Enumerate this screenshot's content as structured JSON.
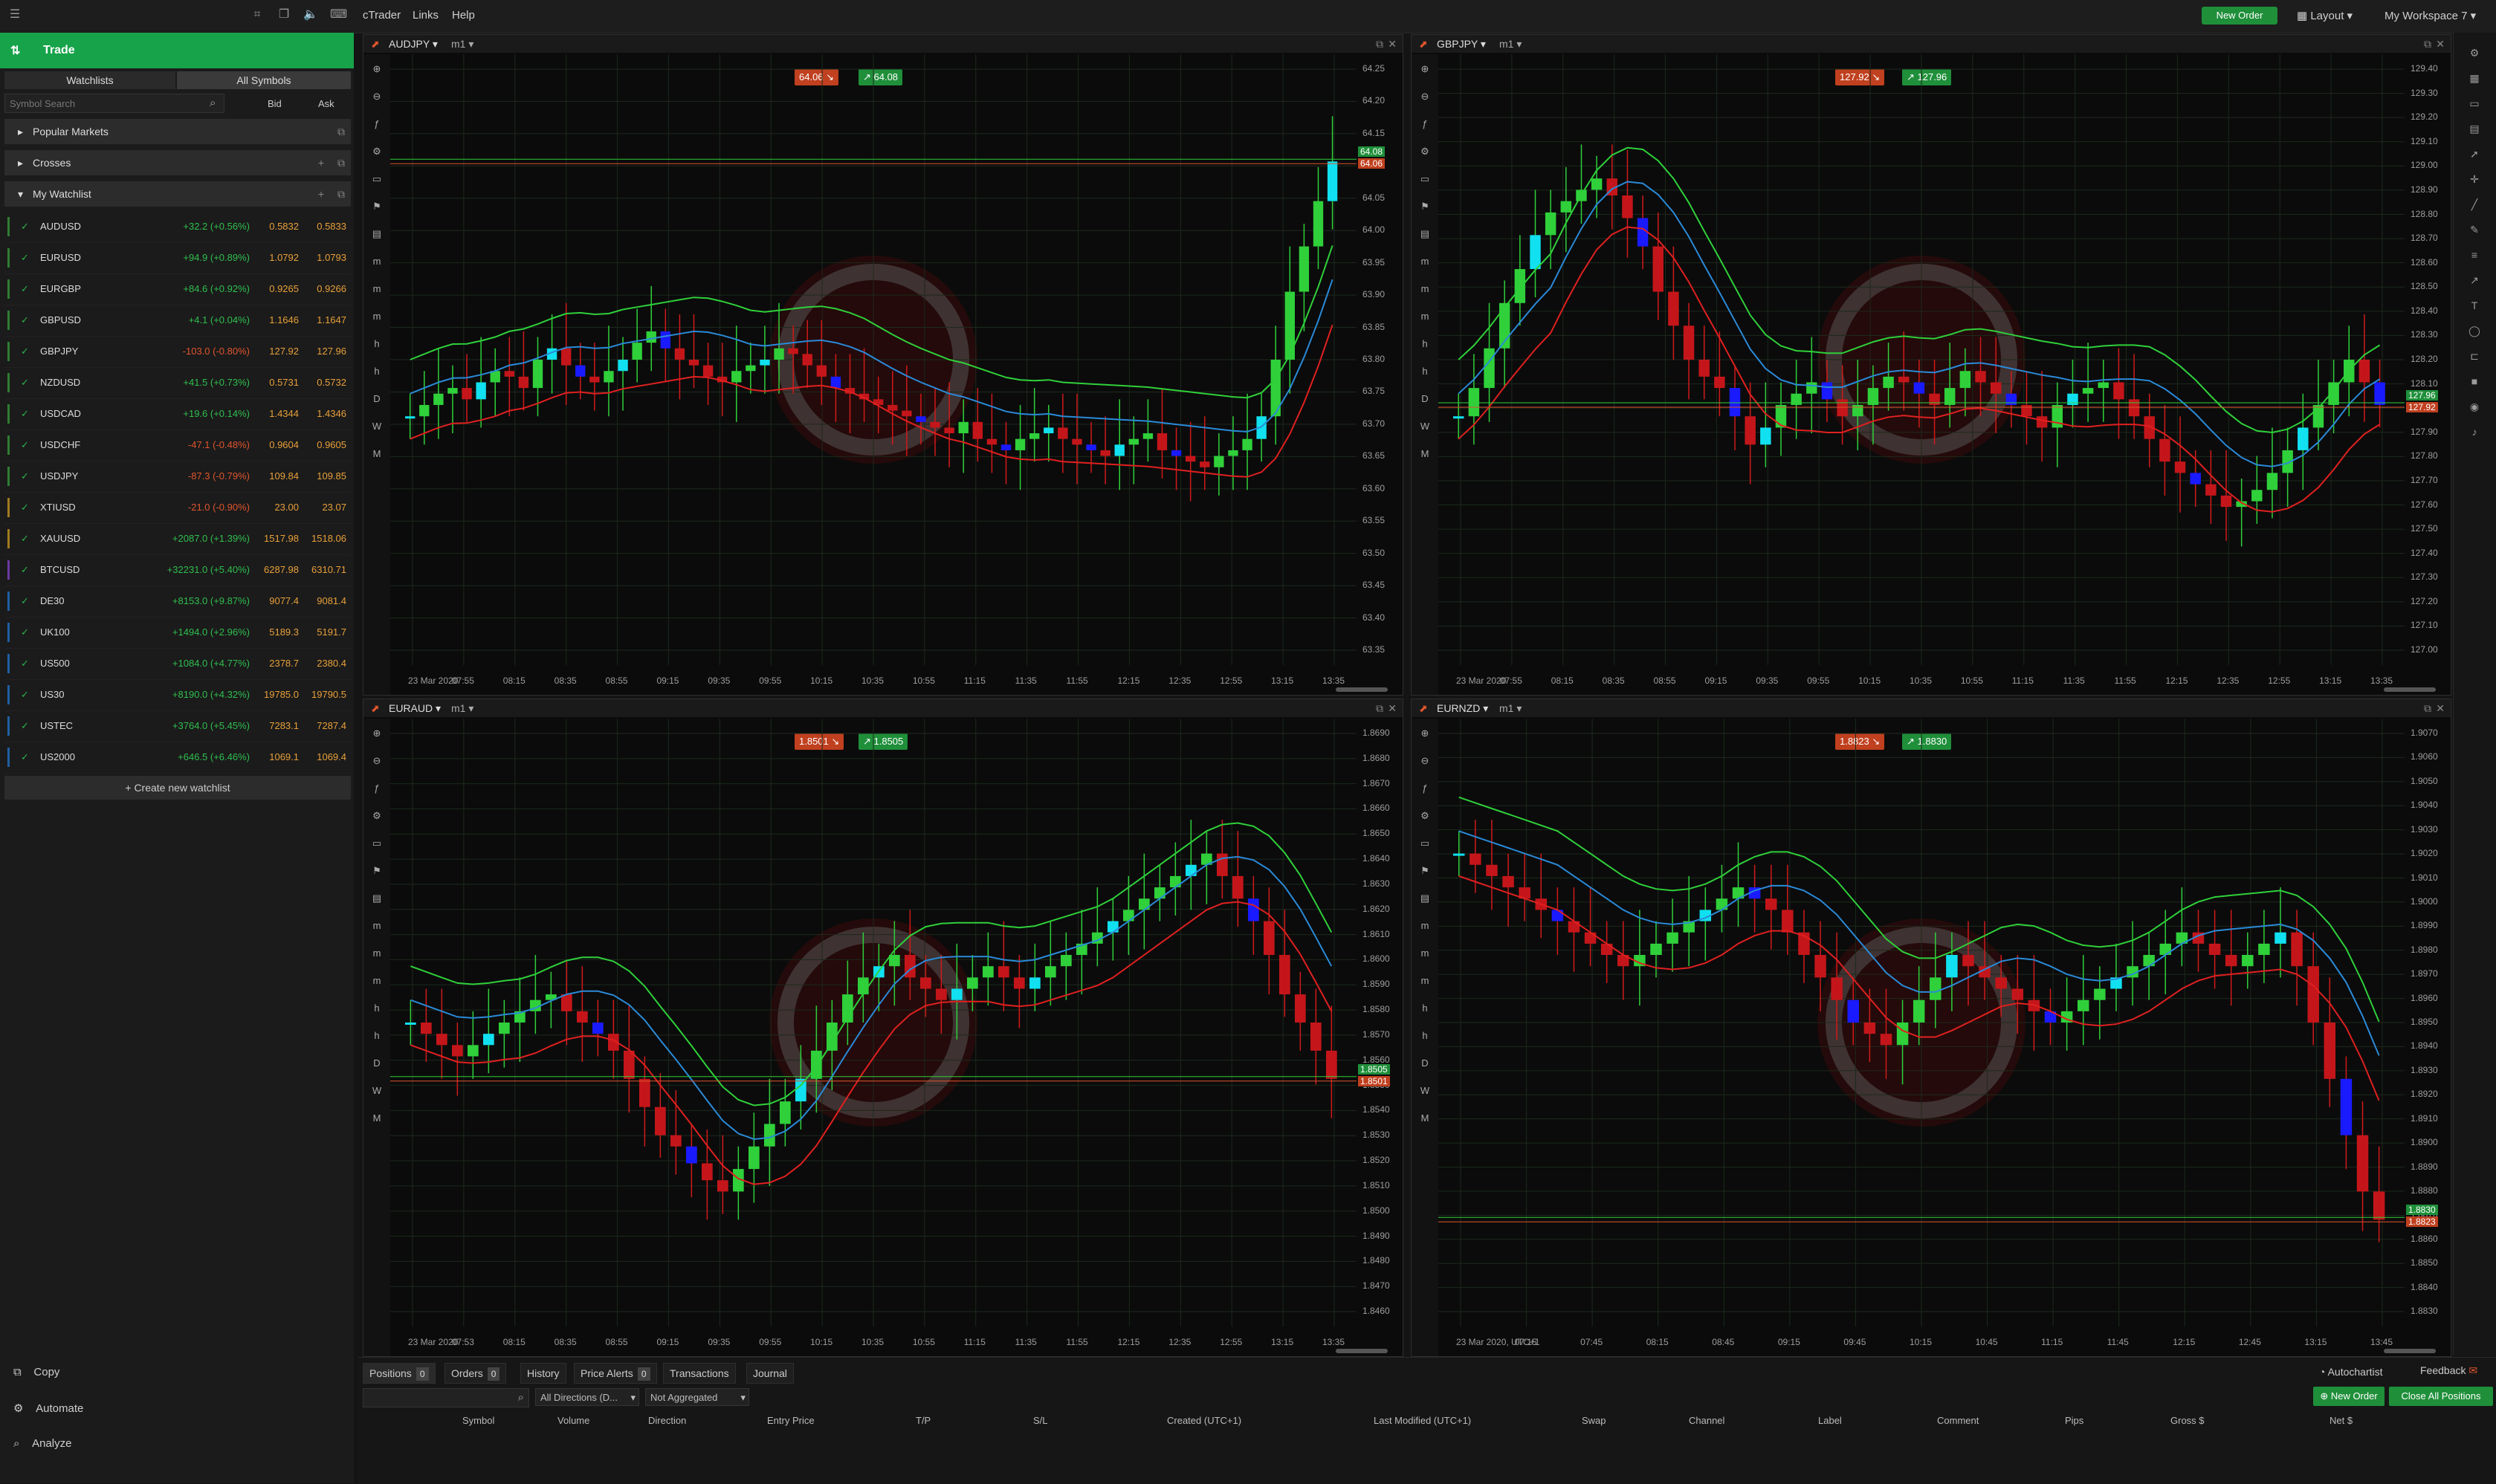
{
  "topbar": {
    "menu": [
      "cTrader",
      "Links",
      "Help"
    ],
    "new_order": "New Order",
    "layout": "Layout",
    "workspace": "My Workspace 7"
  },
  "sidebar": {
    "title": "Trade",
    "tabs": [
      "Watchlists",
      "All Symbols"
    ],
    "search_placeholder": "Symbol Search",
    "col_bid": "Bid",
    "col_ask": "Ask",
    "groups": [
      "Popular Markets",
      "Crosses",
      "My Watchlist"
    ],
    "watchlist": [
      {
        "symbol": "AUDUSD",
        "change": "+32.2 (+0.56%)",
        "bid": "0.5832",
        "ask": "0.5833",
        "color": "#2fbf4f"
      },
      {
        "symbol": "EURUSD",
        "change": "+94.9 (+0.89%)",
        "bid": "1.0792",
        "ask": "1.0793",
        "color": "#2fbf4f"
      },
      {
        "symbol": "EURGBP",
        "change": "+84.6 (+0.92%)",
        "bid": "0.9265",
        "ask": "0.9266",
        "color": "#2fbf4f"
      },
      {
        "symbol": "GBPUSD",
        "change": "+4.1 (+0.04%)",
        "bid": "1.1646",
        "ask": "1.1647",
        "color": "#2fbf4f"
      },
      {
        "symbol": "GBPJPY",
        "change": "-103.0 (-0.80%)",
        "bid": "127.92",
        "ask": "127.96",
        "color": "#e0552d"
      },
      {
        "symbol": "NZDUSD",
        "change": "+41.5 (+0.73%)",
        "bid": "0.5731",
        "ask": "0.5732",
        "color": "#2fbf4f"
      },
      {
        "symbol": "USDCAD",
        "change": "+19.6 (+0.14%)",
        "bid": "1.4344",
        "ask": "1.4346",
        "color": "#2fbf4f"
      },
      {
        "symbol": "USDCHF",
        "change": "-47.1 (-0.48%)",
        "bid": "0.9604",
        "ask": "0.9605",
        "color": "#e0552d"
      },
      {
        "symbol": "USDJPY",
        "change": "-87.3 (-0.79%)",
        "bid": "109.84",
        "ask": "109.85",
        "color": "#e0552d"
      },
      {
        "symbol": "XTIUSD",
        "change": "-21.0 (-0.90%)",
        "bid": "23.00",
        "ask": "23.07",
        "color": "#e0552d"
      },
      {
        "symbol": "XAUUSD",
        "change": "+2087.0 (+1.39%)",
        "bid": "1517.98",
        "ask": "1518.06",
        "color": "#2fbf4f"
      },
      {
        "symbol": "BTCUSD",
        "change": "+32231.0 (+5.40%)",
        "bid": "6287.98",
        "ask": "6310.71",
        "color": "#2fbf4f"
      },
      {
        "symbol": "DE30",
        "change": "+8153.0 (+9.87%)",
        "bid": "9077.4",
        "ask": "9081.4",
        "color": "#2fbf4f"
      },
      {
        "symbol": "UK100",
        "change": "+1494.0 (+2.96%)",
        "bid": "5189.3",
        "ask": "5191.7",
        "color": "#2fbf4f"
      },
      {
        "symbol": "US500",
        "change": "+1084.0 (+4.77%)",
        "bid": "2378.7",
        "ask": "2380.4",
        "color": "#2fbf4f"
      },
      {
        "symbol": "US30",
        "change": "+8190.0 (+4.32%)",
        "bid": "19785.0",
        "ask": "19790.5",
        "color": "#2fbf4f"
      },
      {
        "symbol": "USTEC",
        "change": "+3764.0 (+5.45%)",
        "bid": "7283.1",
        "ask": "7287.4",
        "color": "#2fbf4f"
      },
      {
        "symbol": "US2000",
        "change": "+646.5 (+6.46%)",
        "bid": "1069.1",
        "ask": "1069.4",
        "color": "#2fbf4f"
      }
    ],
    "create_watchlist": "+ Create new watchlist",
    "bottom_nav": [
      "Copy",
      "Automate",
      "Analyze"
    ]
  },
  "charts": [
    {
      "symbol": "AUDJPY",
      "tf": "m1",
      "sell": "64.06",
      "buy": "64.08",
      "y_ticks": [
        "64.25",
        "64.20",
        "64.15",
        "64.10",
        "64.05",
        "64.00",
        "63.95",
        "63.90",
        "63.85",
        "63.80",
        "63.75",
        "63.70",
        "63.65",
        "63.60",
        "63.55",
        "63.50",
        "63.45",
        "63.40",
        "63.35"
      ],
      "x_ticks": [
        "23 Mar 2020",
        "07:55",
        "08:15",
        "08:35",
        "08:55",
        "09:15",
        "09:35",
        "09:55",
        "10:15",
        "10:35",
        "10:55",
        "11:15",
        "11:35",
        "11:55",
        "12:15",
        "12:35",
        "12:55",
        "13:15",
        "13:35"
      ]
    },
    {
      "symbol": "GBPJPY",
      "tf": "m1",
      "sell": "127.92",
      "buy": "127.96",
      "y_ticks": [
        "129.40",
        "129.30",
        "129.20",
        "129.10",
        "129.00",
        "128.90",
        "128.80",
        "128.70",
        "128.60",
        "128.50",
        "128.40",
        "128.30",
        "128.20",
        "128.10",
        "128.00",
        "127.90",
        "127.80",
        "127.70",
        "127.60",
        "127.50",
        "127.40",
        "127.30",
        "127.20",
        "127.10",
        "127.00"
      ],
      "x_ticks": [
        "23 Mar 2020",
        "07:55",
        "08:15",
        "08:35",
        "08:55",
        "09:15",
        "09:35",
        "09:55",
        "10:15",
        "10:35",
        "10:55",
        "11:15",
        "11:35",
        "11:55",
        "12:15",
        "12:35",
        "12:55",
        "13:15",
        "13:35"
      ]
    },
    {
      "symbol": "EURAUD",
      "tf": "m1",
      "sell": "1.8501",
      "buy": "1.8505",
      "y_ticks": [
        "1.8690",
        "1.8680",
        "1.8670",
        "1.8660",
        "1.8650",
        "1.8640",
        "1.8630",
        "1.8620",
        "1.8610",
        "1.8600",
        "1.8590",
        "1.8580",
        "1.8570",
        "1.8560",
        "1.8550",
        "1.8540",
        "1.8530",
        "1.8520",
        "1.8510",
        "1.8500",
        "1.8490",
        "1.8480",
        "1.8470",
        "1.8460"
      ],
      "x_ticks": [
        "23 Mar 2020",
        "07:53",
        "08:15",
        "08:35",
        "08:55",
        "09:15",
        "09:35",
        "09:55",
        "10:15",
        "10:35",
        "10:55",
        "11:15",
        "11:35",
        "11:55",
        "12:15",
        "12:35",
        "12:55",
        "13:15",
        "13:35"
      ]
    },
    {
      "symbol": "EURNZD",
      "tf": "m1",
      "sell": "1.8823",
      "buy": "1.8830",
      "y_ticks": [
        "1.9070",
        "1.9060",
        "1.9050",
        "1.9040",
        "1.9030",
        "1.9020",
        "1.9010",
        "1.9000",
        "1.8990",
        "1.8980",
        "1.8970",
        "1.8960",
        "1.8950",
        "1.8940",
        "1.8930",
        "1.8920",
        "1.8910",
        "1.8900",
        "1.8890",
        "1.8880",
        "1.8870",
        "1.8860",
        "1.8850",
        "1.8840",
        "1.8830"
      ],
      "x_ticks": [
        "23 Mar 2020, UTC+1",
        "07:15",
        "07:45",
        "08:15",
        "08:45",
        "09:15",
        "09:45",
        "10:15",
        "10:45",
        "11:15",
        "11:45",
        "12:15",
        "12:45",
        "13:15",
        "13:45"
      ]
    }
  ],
  "bottom": {
    "tabs": [
      {
        "label": "Positions",
        "count": "0"
      },
      {
        "label": "Orders",
        "count": "0"
      },
      {
        "label": "History",
        "count": ""
      },
      {
        "label": "Price Alerts",
        "count": "0"
      },
      {
        "label": "Transactions",
        "count": ""
      },
      {
        "label": "Journal",
        "count": ""
      }
    ],
    "autochartist": "Autochartist",
    "feedback": "Feedback",
    "filter_direction": "All Directions (D...",
    "filter_aggregate": "Not Aggregated",
    "new_order": "New Order",
    "close_all": "Close All Positions",
    "columns": [
      "Symbol",
      "Volume",
      "Direction",
      "Entry Price",
      "T/P",
      "S/L",
      "Created (UTC+1)",
      "Last Modified (UTC+1)",
      "Swap",
      "Channel",
      "Label",
      "Comment",
      "Pips",
      "Gross $",
      "Net $"
    ]
  }
}
